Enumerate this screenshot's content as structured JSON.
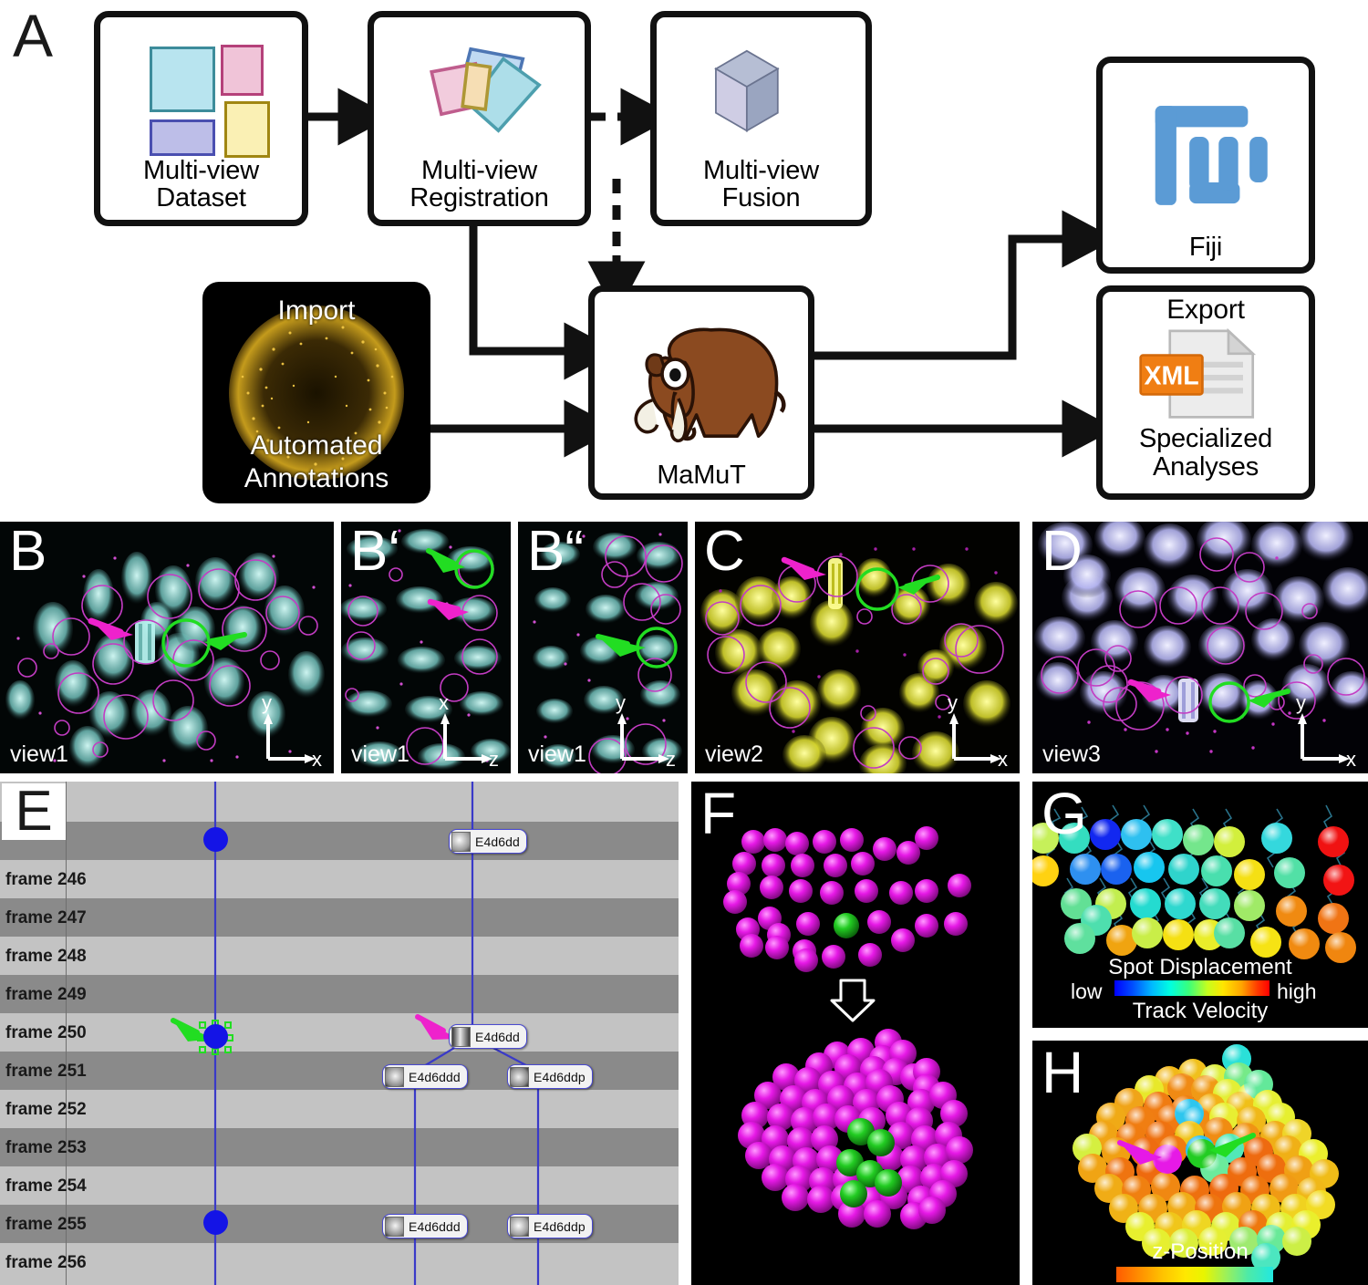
{
  "figure": {
    "panels": [
      "A",
      "B",
      "B'",
      "B''",
      "C",
      "D",
      "E",
      "F",
      "G",
      "H"
    ]
  },
  "panelA": {
    "letter": "A",
    "boxes": [
      {
        "id": "multiview-dataset",
        "label_line1": "Multi-view",
        "label_line2": "Dataset"
      },
      {
        "id": "multiview-registration",
        "label_line1": "Multi-view",
        "label_line2": "Registration"
      },
      {
        "id": "multiview-fusion",
        "label_line1": "Multi-view",
        "label_line2": "Fusion"
      },
      {
        "id": "fiji",
        "label_line1": "Fiji",
        "label_line2": ""
      },
      {
        "id": "mamut",
        "label_line1": "MaMuT",
        "label_line2": ""
      },
      {
        "id": "export-specialized-analyses",
        "label_top": "Export",
        "label_line1": "Specialized",
        "label_line2": "Analyses",
        "badge": "XML"
      }
    ],
    "import_box": {
      "top_label": "Import",
      "bottom_line1": "Automated",
      "bottom_line2": "Annotations"
    },
    "colors": {
      "dataset_cyan": "#b8e4ef",
      "dataset_pink": "#f0c4d8",
      "dataset_purple": "#bdbee8",
      "dataset_yellow": "#faf0b4",
      "cube_front": "#cfcde4",
      "cube_side": "#9aa5c0",
      "cube_top": "#b6bed4",
      "fiji_blue": "#5b9bd5",
      "xml_orange": "#f07e13",
      "mammoth_brown": "#8b4a20"
    }
  },
  "rowB": {
    "panels": [
      {
        "letter": "B",
        "view": "view1",
        "axis_v": "y",
        "axis_h": "x",
        "tint": "#8fe6e0",
        "arrow_green": true,
        "arrow_magenta": true
      },
      {
        "letter": "B‘",
        "view": "view1",
        "axis_v": "x",
        "axis_h": "z",
        "tint": "#8fe6e0",
        "arrow_green": true,
        "arrow_magenta": true
      },
      {
        "letter": "B“",
        "view": "view1",
        "axis_v": "y",
        "axis_h": "z",
        "tint": "#8fe6e0",
        "arrow_green": true,
        "arrow_magenta": false
      },
      {
        "letter": "C",
        "view": "view2",
        "axis_v": "y",
        "axis_h": "x",
        "tint": "#efef3c",
        "arrow_green": true,
        "arrow_magenta": true
      },
      {
        "letter": "D",
        "view": "view3",
        "axis_v": "y",
        "axis_h": "x",
        "tint": "#c3c3f5",
        "arrow_green": true,
        "arrow_magenta": true
      }
    ],
    "annotation_colors": {
      "spot_circle": "#c33cc3",
      "selected_circle": "#22dd22",
      "arrow_green": "#22dd22",
      "arrow_magenta": "#ee22cc"
    }
  },
  "panelE": {
    "letter": "E",
    "frames": [
      "frame 246",
      "frame 247",
      "frame 248",
      "frame 249",
      "frame 250",
      "frame 251",
      "frame 252",
      "frame 253",
      "frame 254",
      "frame 255",
      "frame 256"
    ],
    "spot_tags": [
      {
        "label": "E4d6dd",
        "frame": "",
        "track": "right",
        "row": 0
      },
      {
        "label": "E4d6dd",
        "frame": "frame 250",
        "track": "right",
        "row": 5
      },
      {
        "label": "E4d6ddd",
        "frame": "frame 251",
        "track": "right-left-child",
        "row": 6
      },
      {
        "label": "E4d6ddp",
        "frame": "frame 251",
        "track": "right-right-child",
        "row": 6
      },
      {
        "label": "E4d6ddd",
        "frame": "frame 255",
        "track": "right-left-child",
        "row": 10
      },
      {
        "label": "E4d6ddp",
        "frame": "frame 255",
        "track": "right-right-child",
        "row": 10
      }
    ],
    "colors": {
      "row_dark": "#8a8a8a",
      "row_light": "#c3c3c3",
      "track_line": "#3a3ac8",
      "spot_blue": "#1414e6",
      "selection_green": "#22dd22",
      "arrow_green": "#22dd22",
      "arrow_magenta": "#ee22cc"
    }
  },
  "panelF": {
    "letter": "F",
    "colors": {
      "spot_magenta": "#e619e6",
      "spot_green": "#22cc22",
      "background": "#000000",
      "arrow_outline": "#ffffff"
    },
    "top_cluster_count": 40,
    "bottom_cluster_count": 95,
    "top_green_count": 1,
    "bottom_green_count": 6
  },
  "panelG": {
    "letter": "G",
    "legend_title_top": "Spot Displacement",
    "legend_title_bottom": "Track Velocity",
    "legend_low": "low",
    "legend_high": "high",
    "colorbar": [
      "#0000ff",
      "#00b8ff",
      "#00ffe0",
      "#3bff7a",
      "#c6ff1e",
      "#ffe600",
      "#ffa500",
      "#ff0000"
    ],
    "spot_count": 34
  },
  "panelH": {
    "letter": "H",
    "legend_title": "z-Position",
    "colorbar": [
      "#ff5a00",
      "#ffc400",
      "#ffe800",
      "#9cf05a",
      "#4deaa8",
      "#22e8e0"
    ],
    "spot_count": 90,
    "highlight_green": "#22cc22",
    "highlight_magenta": "#e619e6"
  }
}
